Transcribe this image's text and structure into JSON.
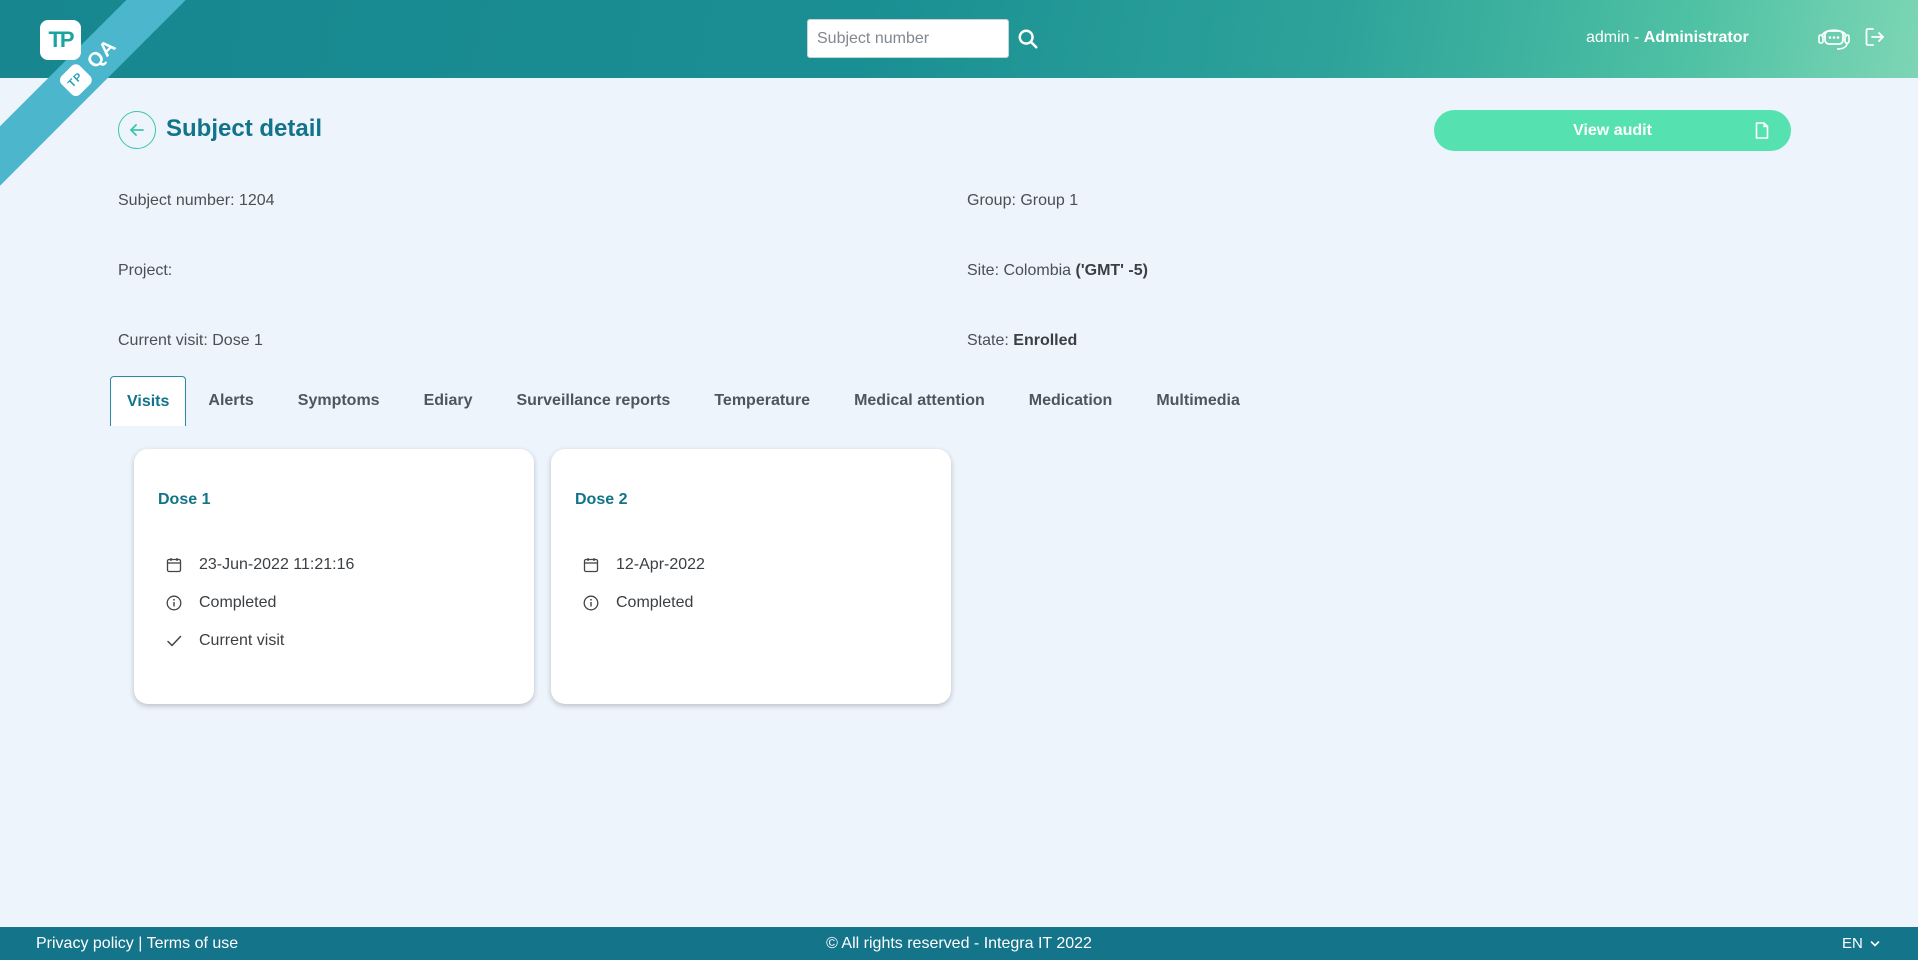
{
  "header": {
    "logo_text": "TP",
    "env_badge": "QA",
    "search_placeholder": "Subject number",
    "user_name": "admin",
    "user_separator": " - ",
    "user_role": "Administrator",
    "icons": {
      "search": "search-icon",
      "support": "headset-chat-icon",
      "logout": "logout-icon"
    }
  },
  "page": {
    "title": "Subject detail",
    "audit_button": "View audit"
  },
  "info": {
    "subject_number": "Subject number: 1204",
    "project": "Project:",
    "current_visit": "Current visit: Dose 1",
    "group": "Group: Group 1",
    "site_label": "Site: Colombia",
    "site_tz": "('GMT' -5)",
    "state_label": "State:",
    "state_value": "Enrolled"
  },
  "tabs": [
    "Visits",
    "Alerts",
    "Symptoms",
    "Ediary",
    "Surveillance reports",
    "Temperature",
    "Medical attention",
    "Medication",
    "Multimedia"
  ],
  "active_tab": "Visits",
  "visits": [
    {
      "title": "Dose 1",
      "date": "23-Jun-2022 11:21:16",
      "status": "Completed",
      "current": "Current visit"
    },
    {
      "title": "Dose 2",
      "date": "12-Apr-2022",
      "status": "Completed"
    }
  ],
  "footer": {
    "privacy": "Privacy policy",
    "separator": " | ",
    "terms": "Terms of use",
    "copyright": "© All rights reserved - Integra IT 2022",
    "language": "EN"
  },
  "colors": {
    "primary": "#12748a",
    "accent": "#56e2b0",
    "background": "#eef4fc"
  }
}
